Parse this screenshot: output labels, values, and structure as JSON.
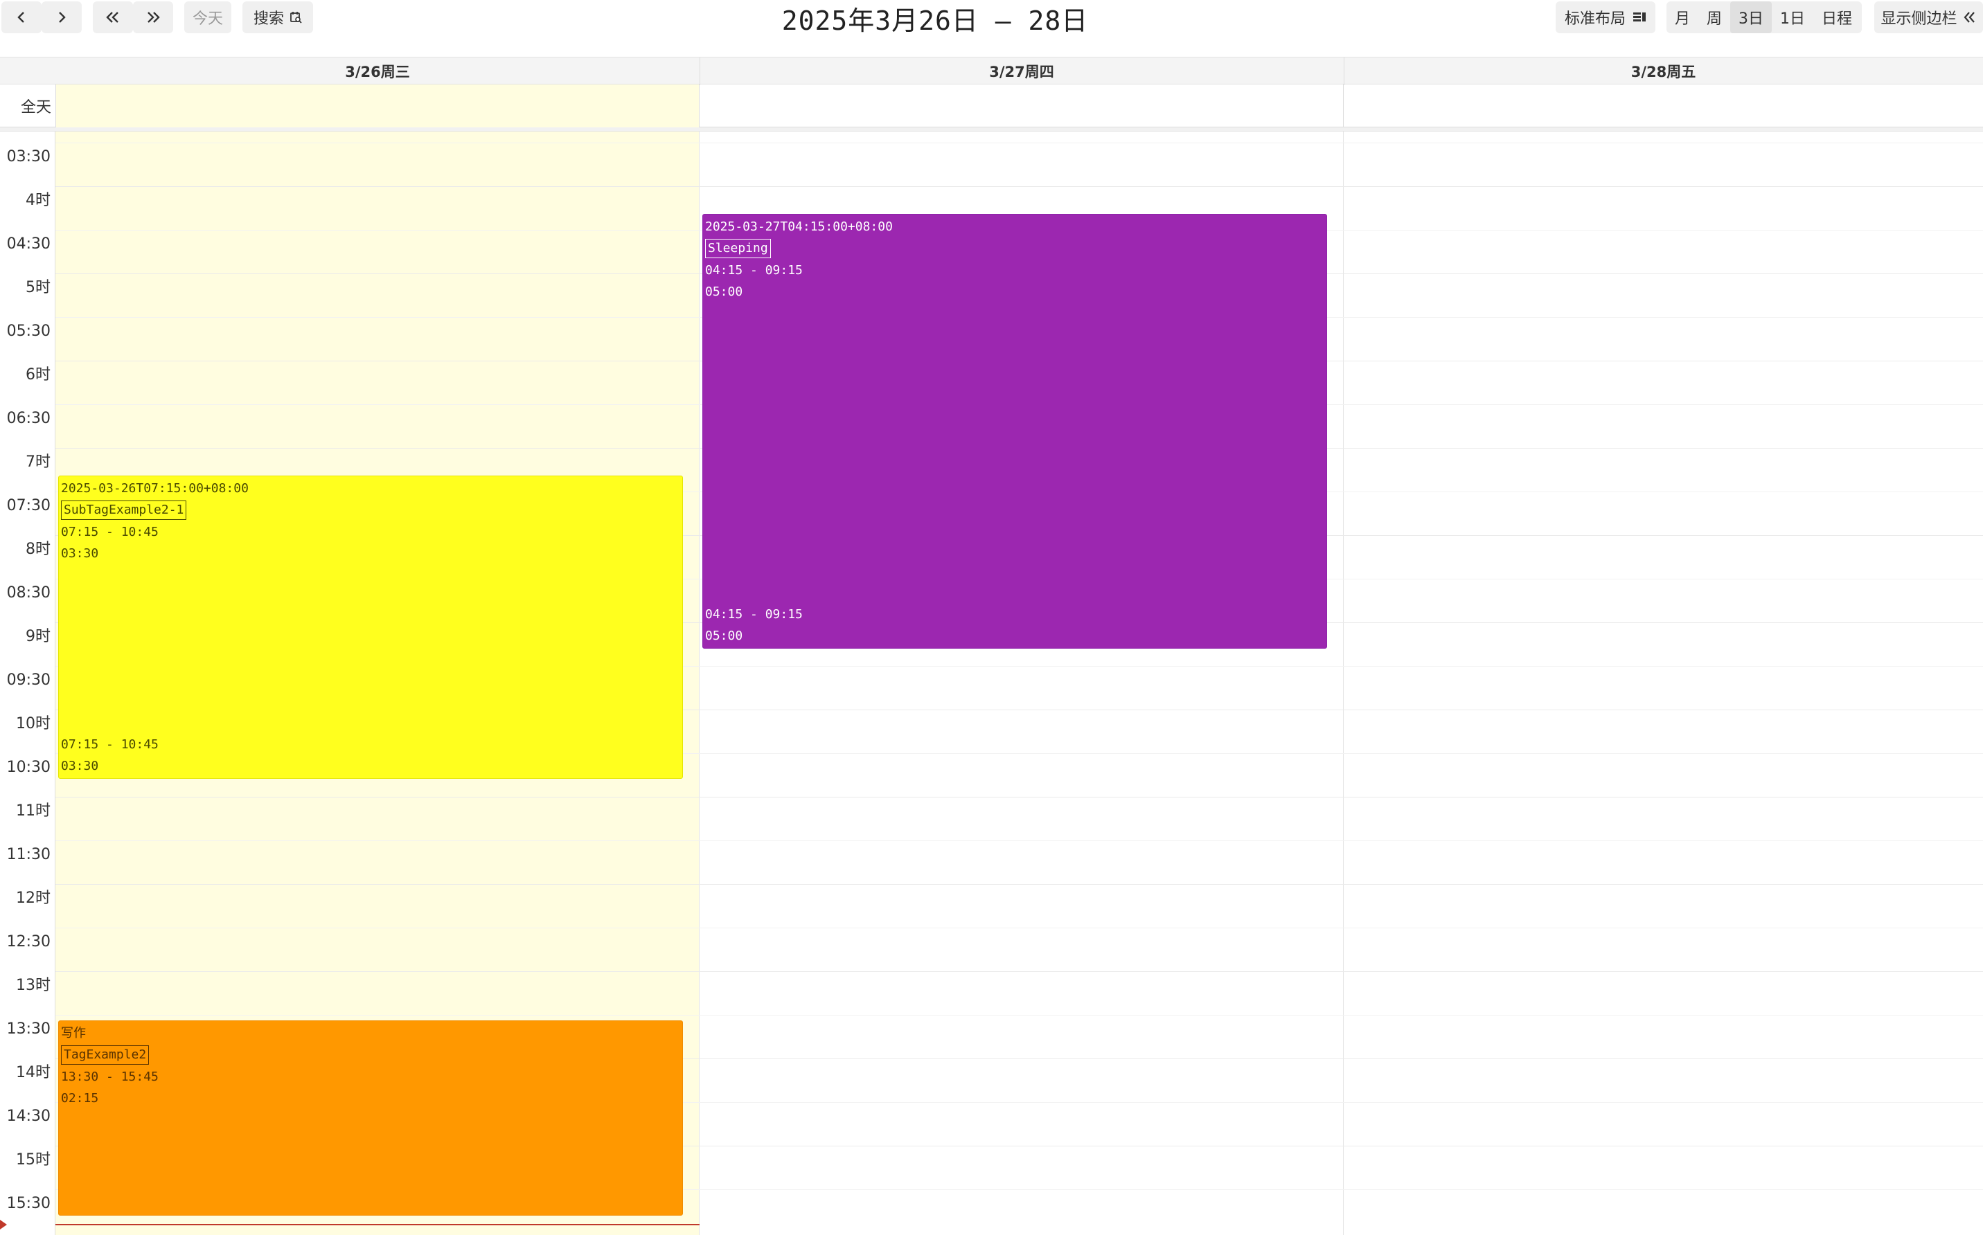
{
  "toolbar": {
    "prev_icon": "chevron-left-icon",
    "next_icon": "chevron-right-icon",
    "prev_big_icon": "double-chevron-left-icon",
    "next_big_icon": "double-chevron-right-icon",
    "today_label": "今天",
    "search_label": "搜索",
    "search_icon": "calendar-search-icon",
    "title": "2025年3月26日 – 28日",
    "layout_label": "标准布局",
    "layout_icon": "layout-icon",
    "views": [
      "月",
      "周",
      "3日",
      "1日",
      "日程"
    ],
    "active_view": "3日",
    "sidebar_label": "显示侧边栏",
    "sidebar_icon": "double-chevron-left-icon"
  },
  "columns": [
    "3/26周三",
    "3/27周四",
    "3/28周五"
  ],
  "today_column": "3/26周三",
  "allday_label": "全天",
  "time_labels": [
    "03:30",
    "4时",
    "04:30",
    "5时",
    "05:30",
    "6时",
    "06:30",
    "7时",
    "07:30",
    "8时",
    "08:30",
    "9时",
    "09:30",
    "10时",
    "10:30",
    "11时",
    "11:30",
    "12时",
    "12:30",
    "13时",
    "13:30",
    "14时",
    "14:30",
    "15时",
    "15:30"
  ],
  "events": {
    "sub_tag": {
      "title": "2025-03-26T07:15:00+08:00",
      "tag": "SubTagExample2-1",
      "time": "07:15 - 10:45",
      "duration": "03:30",
      "color": "#ffff1e"
    },
    "sleeping": {
      "title": "2025-03-27T04:15:00+08:00",
      "tag": "Sleeping",
      "time": "04:15 - 09:15",
      "duration": "05:00",
      "color": "#9c27b0"
    },
    "writing": {
      "title": "写作",
      "tag": "TagExample2",
      "time": "13:30 - 15:45",
      "duration": "02:15",
      "color": "#ff9800"
    }
  },
  "colors": {
    "today_bg": "#fffde0",
    "now_line": "#c0392b"
  }
}
